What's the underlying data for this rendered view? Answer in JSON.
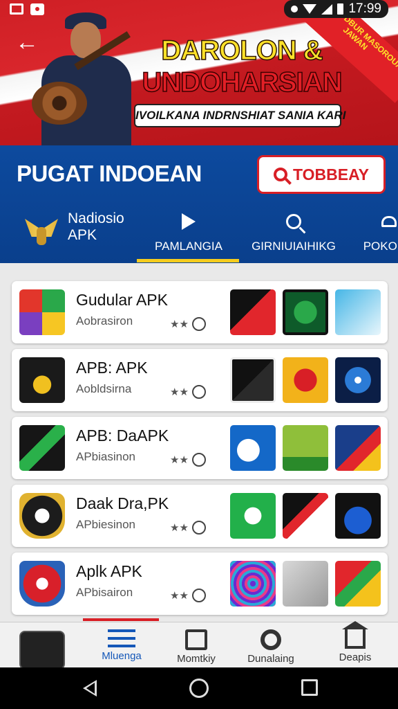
{
  "status_bar": {
    "time": "17:99"
  },
  "banner": {
    "title_line1": "DAROLON &",
    "title_line2": "UNDOHARSIAN",
    "subtitle": "IVOILKANA INDRNSHIAT SANIA KARI",
    "ribbon_text": "NASUOR DBUR MASOROUAN JAWAN"
  },
  "header": {
    "app_title": "PUGAT INDOEAN",
    "top_button_label": "TOBBEAY"
  },
  "tabs": {
    "brand_line1": "Nadiosio",
    "brand_line2": "APK",
    "items": [
      {
        "label": "PAMLANGIA",
        "icon": "play-icon"
      },
      {
        "label": "GIRNIUIAIHIKG",
        "icon": "search-icon"
      },
      {
        "label": "POKONG",
        "icon": "cloud-icon"
      }
    ],
    "active_index": 0
  },
  "apps": [
    {
      "title": "Gudular APK",
      "subtitle": "Aobrasiron",
      "rating": "★★"
    },
    {
      "title": "APB: APK",
      "subtitle": "Aobldsirna",
      "rating": "★★"
    },
    {
      "title": "APB: DaAPK",
      "subtitle": "APbiasinon",
      "rating": "★★"
    },
    {
      "title": "Daak Dra,PK",
      "subtitle": "APbiesinon",
      "rating": "★★"
    },
    {
      "title": "Aplk APK",
      "subtitle": "APbisairon",
      "rating": "★★"
    }
  ],
  "bottom_nav": {
    "items": [
      {
        "label": "Mluenga",
        "icon": "menu-icon"
      },
      {
        "label": "Momtkiy",
        "icon": "news-icon"
      },
      {
        "label": "Dunalaing",
        "icon": "gear-icon"
      },
      {
        "label": "Deapis",
        "icon": "home-icon"
      }
    ]
  },
  "colors": {
    "brand_red": "#d81f26",
    "brand_blue": "#0d4a9e",
    "accent_yellow": "#f5cc1e"
  }
}
